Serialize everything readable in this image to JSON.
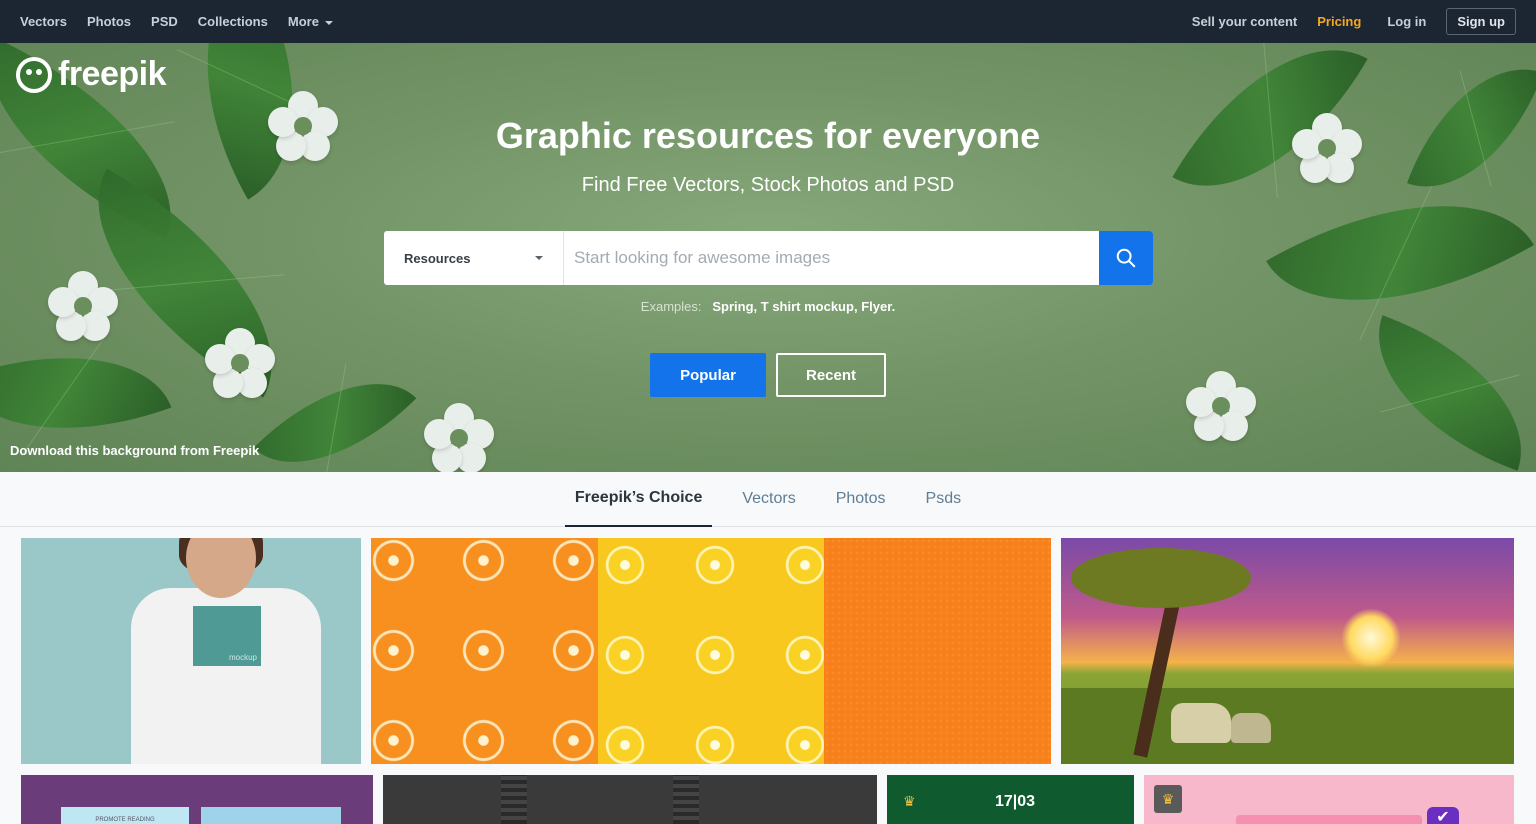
{
  "topnav": {
    "left": [
      {
        "label": "Vectors"
      },
      {
        "label": "Photos"
      },
      {
        "label": "PSD"
      },
      {
        "label": "Collections"
      },
      {
        "label": "More"
      }
    ],
    "sell_label": "Sell your content",
    "pricing_label": "Pricing",
    "login_label": "Log in",
    "signup_label": "Sign up",
    "pricing_color": "#f5a623"
  },
  "hero": {
    "logo": "freepik",
    "title": "Graphic resources for everyone",
    "subtitle": "Find Free Vectors, Stock Photos and PSD",
    "search": {
      "select_value": "Resources",
      "placeholder": "Start looking for awesome images",
      "value": ""
    },
    "examples_label": "Examples:",
    "examples": [
      "Spring",
      "T shirt mockup",
      "Flyer"
    ],
    "popular_label": "Popular",
    "recent_label": "Recent",
    "credit": "Download this background from Freepik",
    "accent_color": "#1273eb"
  },
  "tabs": [
    {
      "label": "Freepik’s Choice",
      "active": true
    },
    {
      "label": "Vectors",
      "active": false
    },
    {
      "label": "Photos",
      "active": false
    },
    {
      "label": "Psds",
      "active": false
    }
  ],
  "grid": {
    "shirt_print": "mockup",
    "promo_text": "PROMOTE READING",
    "event_date": "17|03"
  }
}
